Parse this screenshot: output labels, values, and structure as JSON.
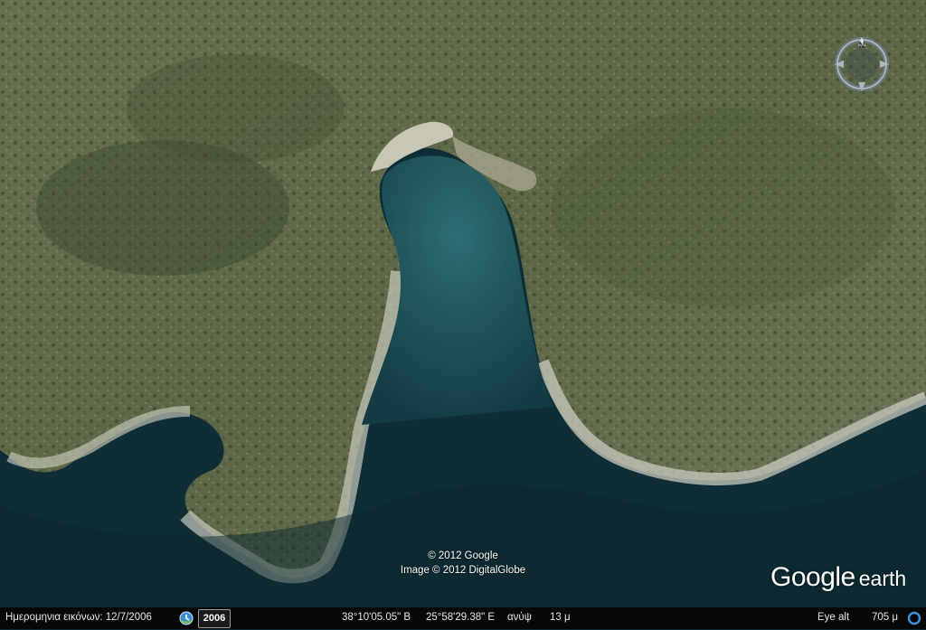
{
  "attribution": {
    "line1": "© 2012 Google",
    "line2": "Image © 2012 DigitalGlobe"
  },
  "logo": {
    "word1": "Google",
    "word2": "earth"
  },
  "compass": {
    "north_label": "N",
    "icon": "compass-icon"
  },
  "statusbar": {
    "imagery_date_label": "Ημερομηνια εικόνων: 12/7/2006",
    "historical_year": "2006",
    "latitude": "38°10'05.05\" Β",
    "longitude": "25°58'29.38\" Ε",
    "elevation_label": "ανύψ",
    "elevation": "13 μ",
    "eye_alt_label": "Eye alt",
    "eye_alt": "705 μ"
  },
  "colors": {
    "land": "#5e6a47",
    "rock": "#b9bcae",
    "water_shallow": "#1f5d66",
    "water_deep": "#0f2f38",
    "statusbar": "#070707"
  }
}
